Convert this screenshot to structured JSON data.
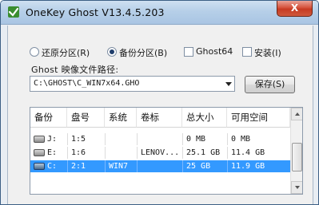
{
  "window": {
    "title": "OneKey Ghost V13.4.5.203",
    "close_glyph": "X",
    "icon": "ghost-app-icon",
    "close_color": "#c63a22"
  },
  "options": {
    "restore_label": "还原分区(R)",
    "backup_label": "备份分区(B)",
    "ghost64_label": "Ghost64",
    "install_label": "安装(I)",
    "selected": "backup"
  },
  "path": {
    "caption": "Ghost 映像文件路径:",
    "value": "C:\\GHOST\\C_WIN7x64.GHO"
  },
  "save_button": {
    "label": "保存(S)"
  },
  "table": {
    "columns": [
      "备份",
      "盘号",
      "系统",
      "卷标",
      "总大小",
      "可用空间"
    ],
    "rows": [
      {
        "drive": "J:",
        "disk": "1:5",
        "system": "",
        "label": "",
        "total": "0 MB",
        "free": "0 MB",
        "selected": false
      },
      {
        "drive": "E:",
        "disk": "1:6",
        "system": "",
        "label": "LENOV...",
        "total": "25.1 GB",
        "free": "11.4 GB",
        "selected": false
      },
      {
        "drive": "C:",
        "disk": "2:1",
        "system": "WIN7",
        "label": "",
        "total": "25 GB",
        "free": "11.9 GB",
        "selected": true
      }
    ],
    "selection_color": "#3399ff"
  }
}
